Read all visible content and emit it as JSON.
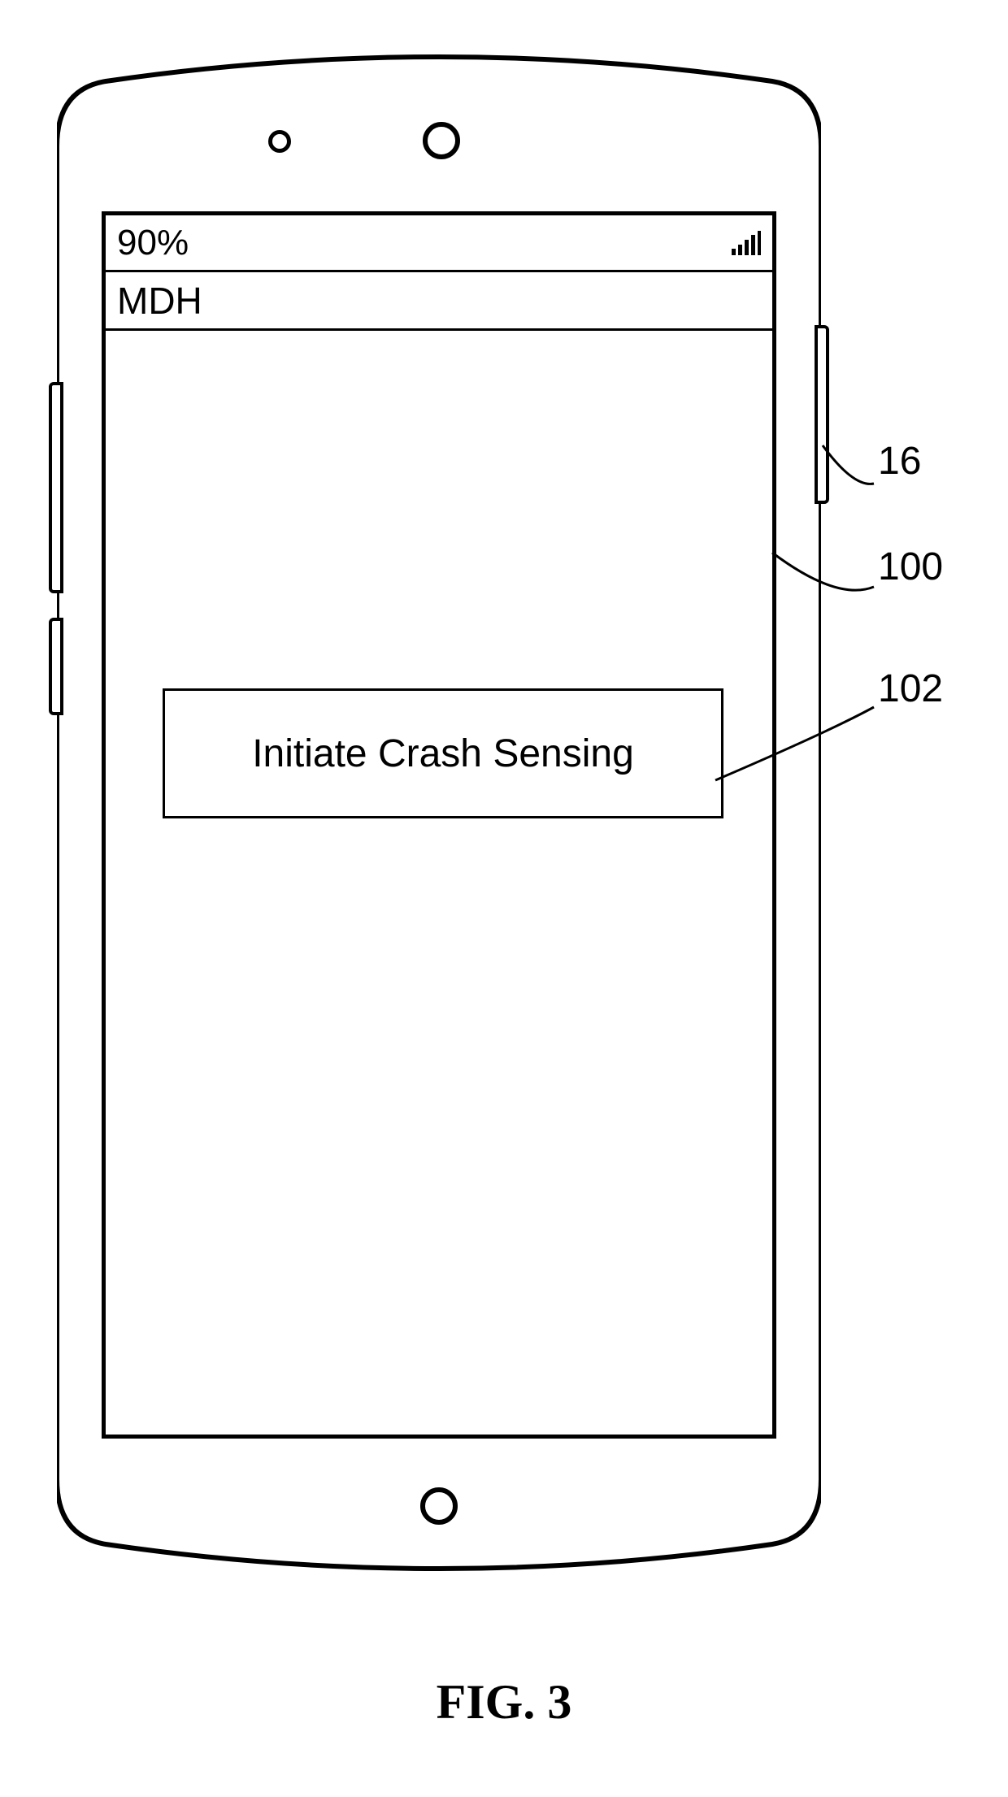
{
  "status_bar": {
    "battery": "90%",
    "signal_icon": "signal-icon"
  },
  "title_bar": {
    "title": "MDH"
  },
  "main": {
    "button_label": "Initiate Crash Sensing"
  },
  "callouts": {
    "device": "16",
    "screen": "100",
    "button": "102"
  },
  "figure_label": "FIG. 3"
}
